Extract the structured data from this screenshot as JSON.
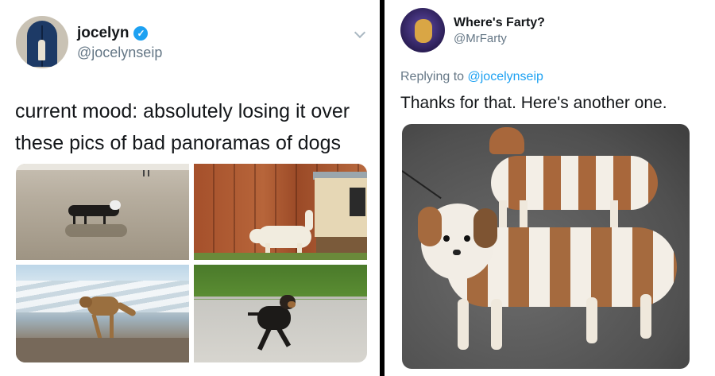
{
  "left_tweet": {
    "display_name": "jocelyn",
    "handle": "@jocelynseip",
    "verified": true,
    "text": "current mood: absolutely losing it over these pics of bad panoramas of dogs",
    "icons": {
      "verified": "verified-badge-icon",
      "menu": "chevron-down-icon"
    },
    "photos": [
      {
        "name": "photo-beach-dog"
      },
      {
        "name": "photo-fence-dog"
      },
      {
        "name": "photo-waves-dog"
      },
      {
        "name": "photo-grass-dog"
      }
    ]
  },
  "right_tweet": {
    "display_name": "Where's Farty?",
    "handle": "@MrFarty",
    "replying_prefix": "Replying to",
    "replying_handle": "@jocelynseip",
    "text": "Thanks for that. Here's another one.",
    "photo": {
      "name": "photo-shihtzu-panorama"
    }
  },
  "colors": {
    "accent": "#1da1f2",
    "text": "#14171a",
    "secondary_text": "#657786",
    "divider": "#000000"
  }
}
